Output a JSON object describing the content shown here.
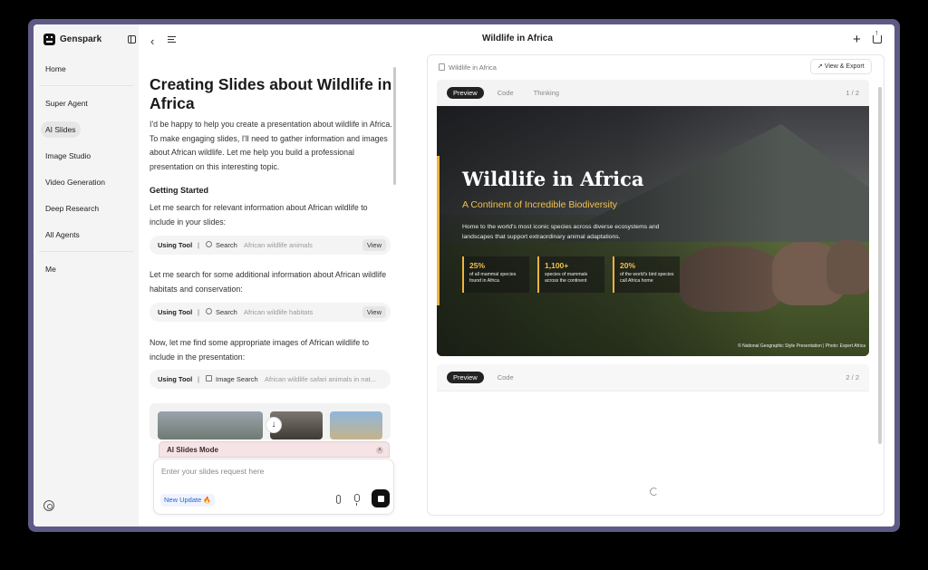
{
  "app": {
    "name": "Genspark"
  },
  "sidebar": {
    "items": [
      {
        "label": "Home"
      },
      {
        "label": "Super Agent"
      },
      {
        "label": "AI Slides"
      },
      {
        "label": "Image Studio"
      },
      {
        "label": "Video Generation"
      },
      {
        "label": "Deep Research"
      },
      {
        "label": "All Agents"
      },
      {
        "label": "Me"
      }
    ],
    "active_item": "AI Slides"
  },
  "header": {
    "title": "Wildlife in Africa"
  },
  "chat": {
    "heading": "Creating Slides about Wildlife in Africa",
    "intro": "I'd be happy to help you create a presentation about wildlife in Africa. To make engaging slides, I'll need to gather information and images about African wildlife. Let me help you build a professional presentation on this interesting topic.",
    "section_title": "Getting Started",
    "step1": "Let me search for relevant information about African wildlife to include in your slides:",
    "tool1": {
      "label": "Using Tool",
      "sep": "|",
      "name": "Search",
      "query": "African wildlife animals",
      "action": "View"
    },
    "step2": "Let me search for some additional information about African wildlife habitats and conservation:",
    "tool2": {
      "label": "Using Tool",
      "sep": "|",
      "name": "Search",
      "query": "African wildlife habitats",
      "action": "View"
    },
    "step3": "Now, let me find some appropriate images of African wildlife to include in the presentation:",
    "tool3": {
      "label": "Using Tool",
      "sep": "|",
      "name": "Image Search",
      "query": "African wildlife safari animals in nat..."
    },
    "scroll_down_icon": "arrow-down-icon"
  },
  "composer": {
    "mode_label": "AI Slides Mode",
    "placeholder": "Enter your slides request here",
    "value": "",
    "badge": "New Update",
    "badge_icon": "fire-icon"
  },
  "preview": {
    "file_name": "Wildlife in Africa",
    "export_label": "View & Export",
    "card1": {
      "tabs": [
        "Preview",
        "Code",
        "Thinking"
      ],
      "active_tab": "Preview",
      "page": "1 / 2",
      "slide": {
        "title": "Wildlife in Africa",
        "subtitle": "A Continent of Incredible Biodiversity",
        "description": "Home to the world's most iconic species across diverse ecosystems and landscapes that support extraordinary animal adaptations.",
        "stats": [
          {
            "value": "25%",
            "label": "of all mammal species found in Africa"
          },
          {
            "value": "1,100+",
            "label": "species of mammals across the continent"
          },
          {
            "value": "20%",
            "label": "of the world's bird species call Africa home"
          }
        ],
        "credit": "© National Geographic Style Presentation | Photo: Expert Africa",
        "accent_color": "#f0b33c"
      }
    },
    "card2": {
      "tabs": [
        "Preview",
        "Code"
      ],
      "active_tab": "Preview",
      "page": "2 / 2",
      "status": "loading"
    }
  }
}
